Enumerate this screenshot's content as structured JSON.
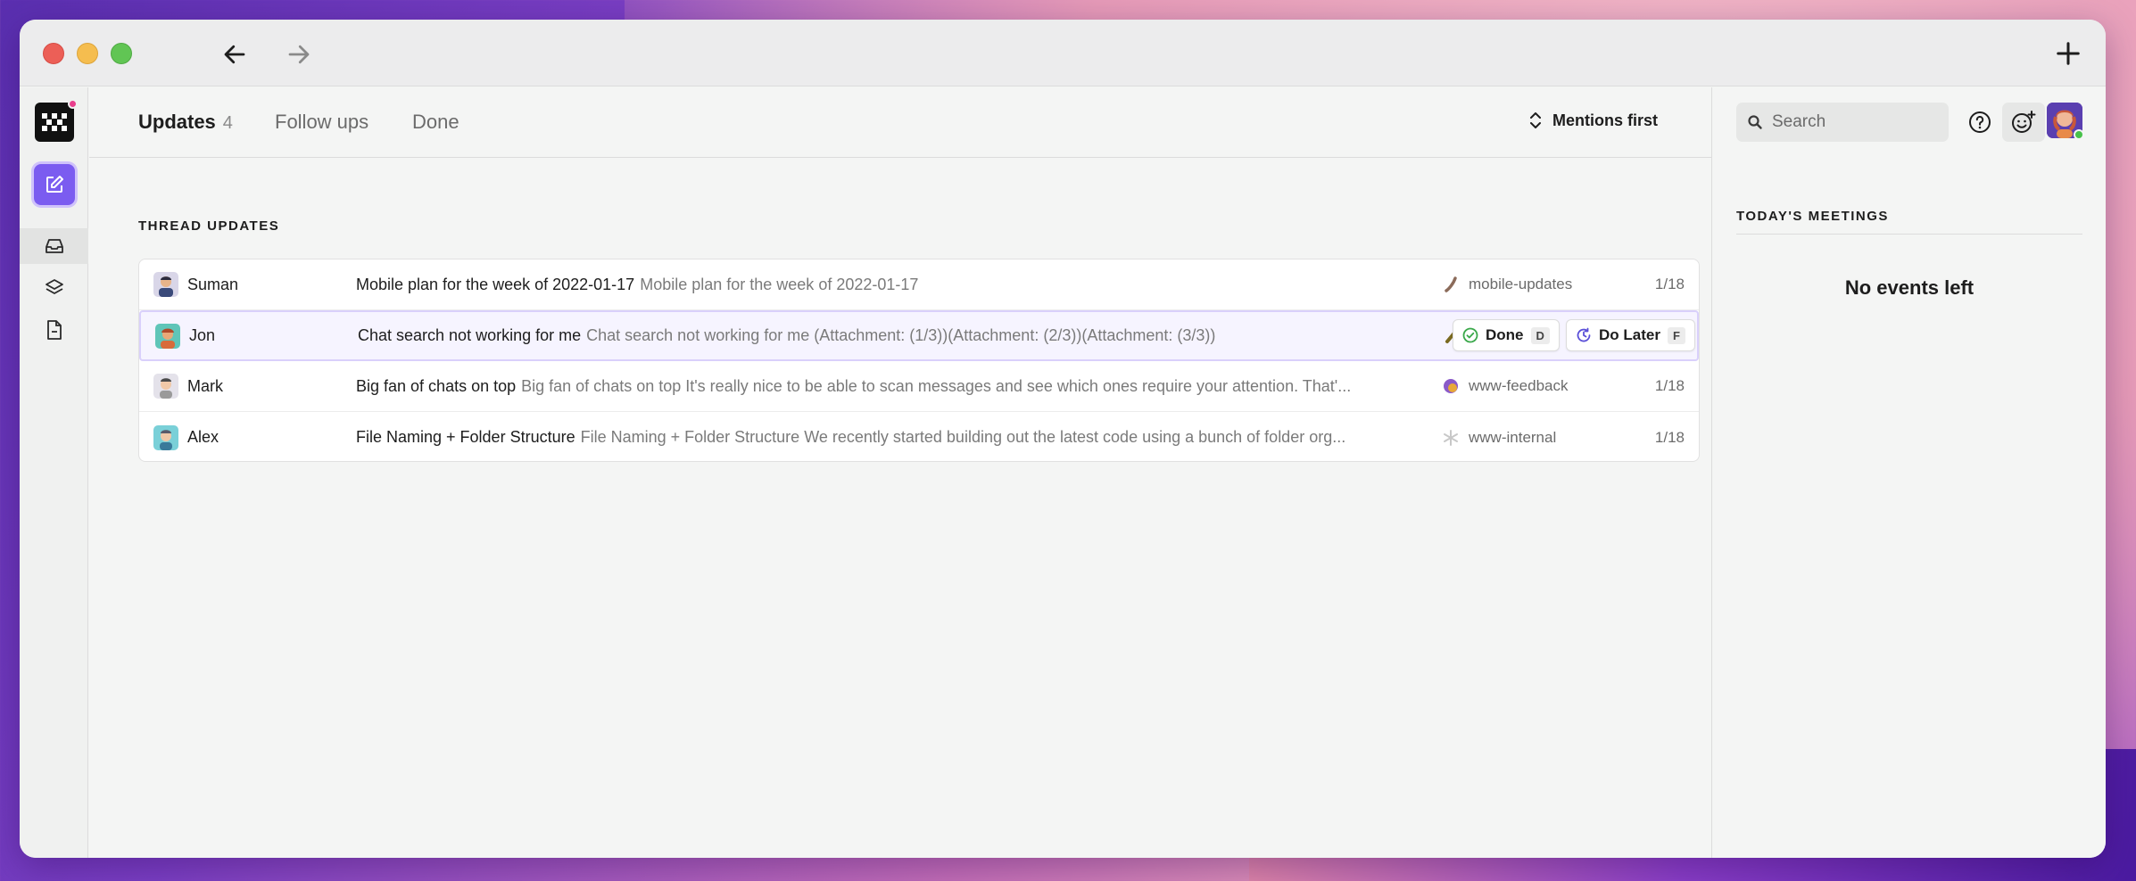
{
  "titlebar": {
    "back_icon": "arrow-left-icon",
    "forward_icon": "arrow-right-icon",
    "new_icon": "plus-icon"
  },
  "tabs": [
    {
      "label": "Updates",
      "count": "4",
      "active": true
    },
    {
      "label": "Follow ups"
    },
    {
      "label": "Done"
    }
  ],
  "sort": {
    "label": "Mentions first",
    "icon": "updown-chevron-icon"
  },
  "section_title": "THREAD UPDATES",
  "threads": [
    {
      "sender": "Suman",
      "title": "Mobile plan for the week of 2022-01-17",
      "preview": "Mobile plan for the week of 2022-01-17",
      "channel": "mobile-updates",
      "date": "1/18"
    },
    {
      "sender": "Jon",
      "title": "Chat search not working for me",
      "preview": "Chat search not working for me (Attachment: (1/3))(Attachment: (2/3))(Attachment: (3/3))",
      "channel": "",
      "date": "",
      "selected": true
    },
    {
      "sender": "Mark",
      "title": "Big fan of chats on top",
      "preview": "Big fan of chats on top It's really nice to be able to scan messages and see which ones require your attention. That'...",
      "channel": "www-feedback",
      "date": "1/18"
    },
    {
      "sender": "Alex",
      "title": "File Naming + Folder Structure",
      "preview": "File Naming + Folder Structure We recently started building out the latest code using a bunch of folder org...",
      "channel": "www-internal",
      "date": "1/18"
    }
  ],
  "row_actions": {
    "done_label": "Done",
    "done_key": "D",
    "later_label": "Do Later",
    "later_key": "F"
  },
  "right_panel": {
    "search_placeholder": "Search",
    "meetings_title": "TODAY'S MEETINGS",
    "no_events": "No events left"
  },
  "colors": {
    "accent": "#7b5cf0",
    "status_online": "#47c14a",
    "notification_dot": "#e83e8c"
  }
}
